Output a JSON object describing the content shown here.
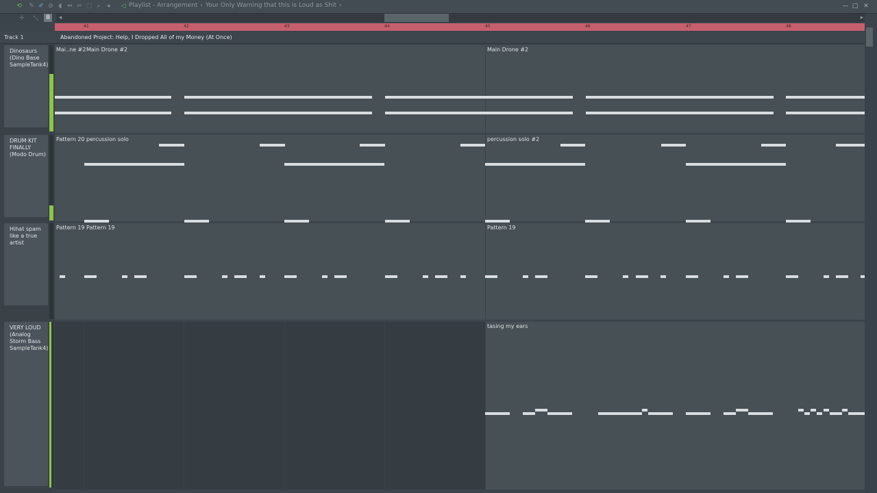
{
  "titlebar": {
    "title": "Playlist - Arrangement",
    "subtitle": "Your Only Warning that this is Loud as Shit"
  },
  "window_controls": [
    "—",
    "□",
    "✕"
  ],
  "ruler": {
    "bars": [
      "41",
      "42",
      "43",
      "44",
      "45",
      "46",
      "47",
      "48"
    ]
  },
  "track": {
    "name": "Track 1"
  },
  "marker": {
    "label": "Abandoned Project: Help, I Dropped All of my Money (At Once)"
  },
  "tracks": [
    {
      "label": "Dinosaurs (Dino Base SampleTank4)",
      "clips": [
        "Mai..ne #2",
        "Main Drone #2",
        "Main Drone #2"
      ]
    },
    {
      "label": "DRUM KIT FINALLY (Modo Drum)",
      "clips": [
        "Pattern 20",
        "percussion solo",
        "percussion solo #2"
      ]
    },
    {
      "label": "Hihat spam like a true artist",
      "clips": [
        "Pattern 19",
        "Pattern 19",
        "Pattern 19"
      ]
    },
    {
      "label": "VERY LOUD (Analog Storm Bass SampleTank4)",
      "clips": [
        "tasing my ears"
      ]
    }
  ],
  "colors": {
    "ruler": "#c65f6d",
    "level": "#8cc447",
    "lane": "#475055",
    "note": "#d8dde0"
  },
  "icons": [
    "stamp-icon",
    "draw-icon",
    "paint-icon",
    "delete-icon",
    "mute-icon",
    "slip-icon",
    "slice-icon",
    "select-icon",
    "zoom-icon",
    "play-icon"
  ]
}
